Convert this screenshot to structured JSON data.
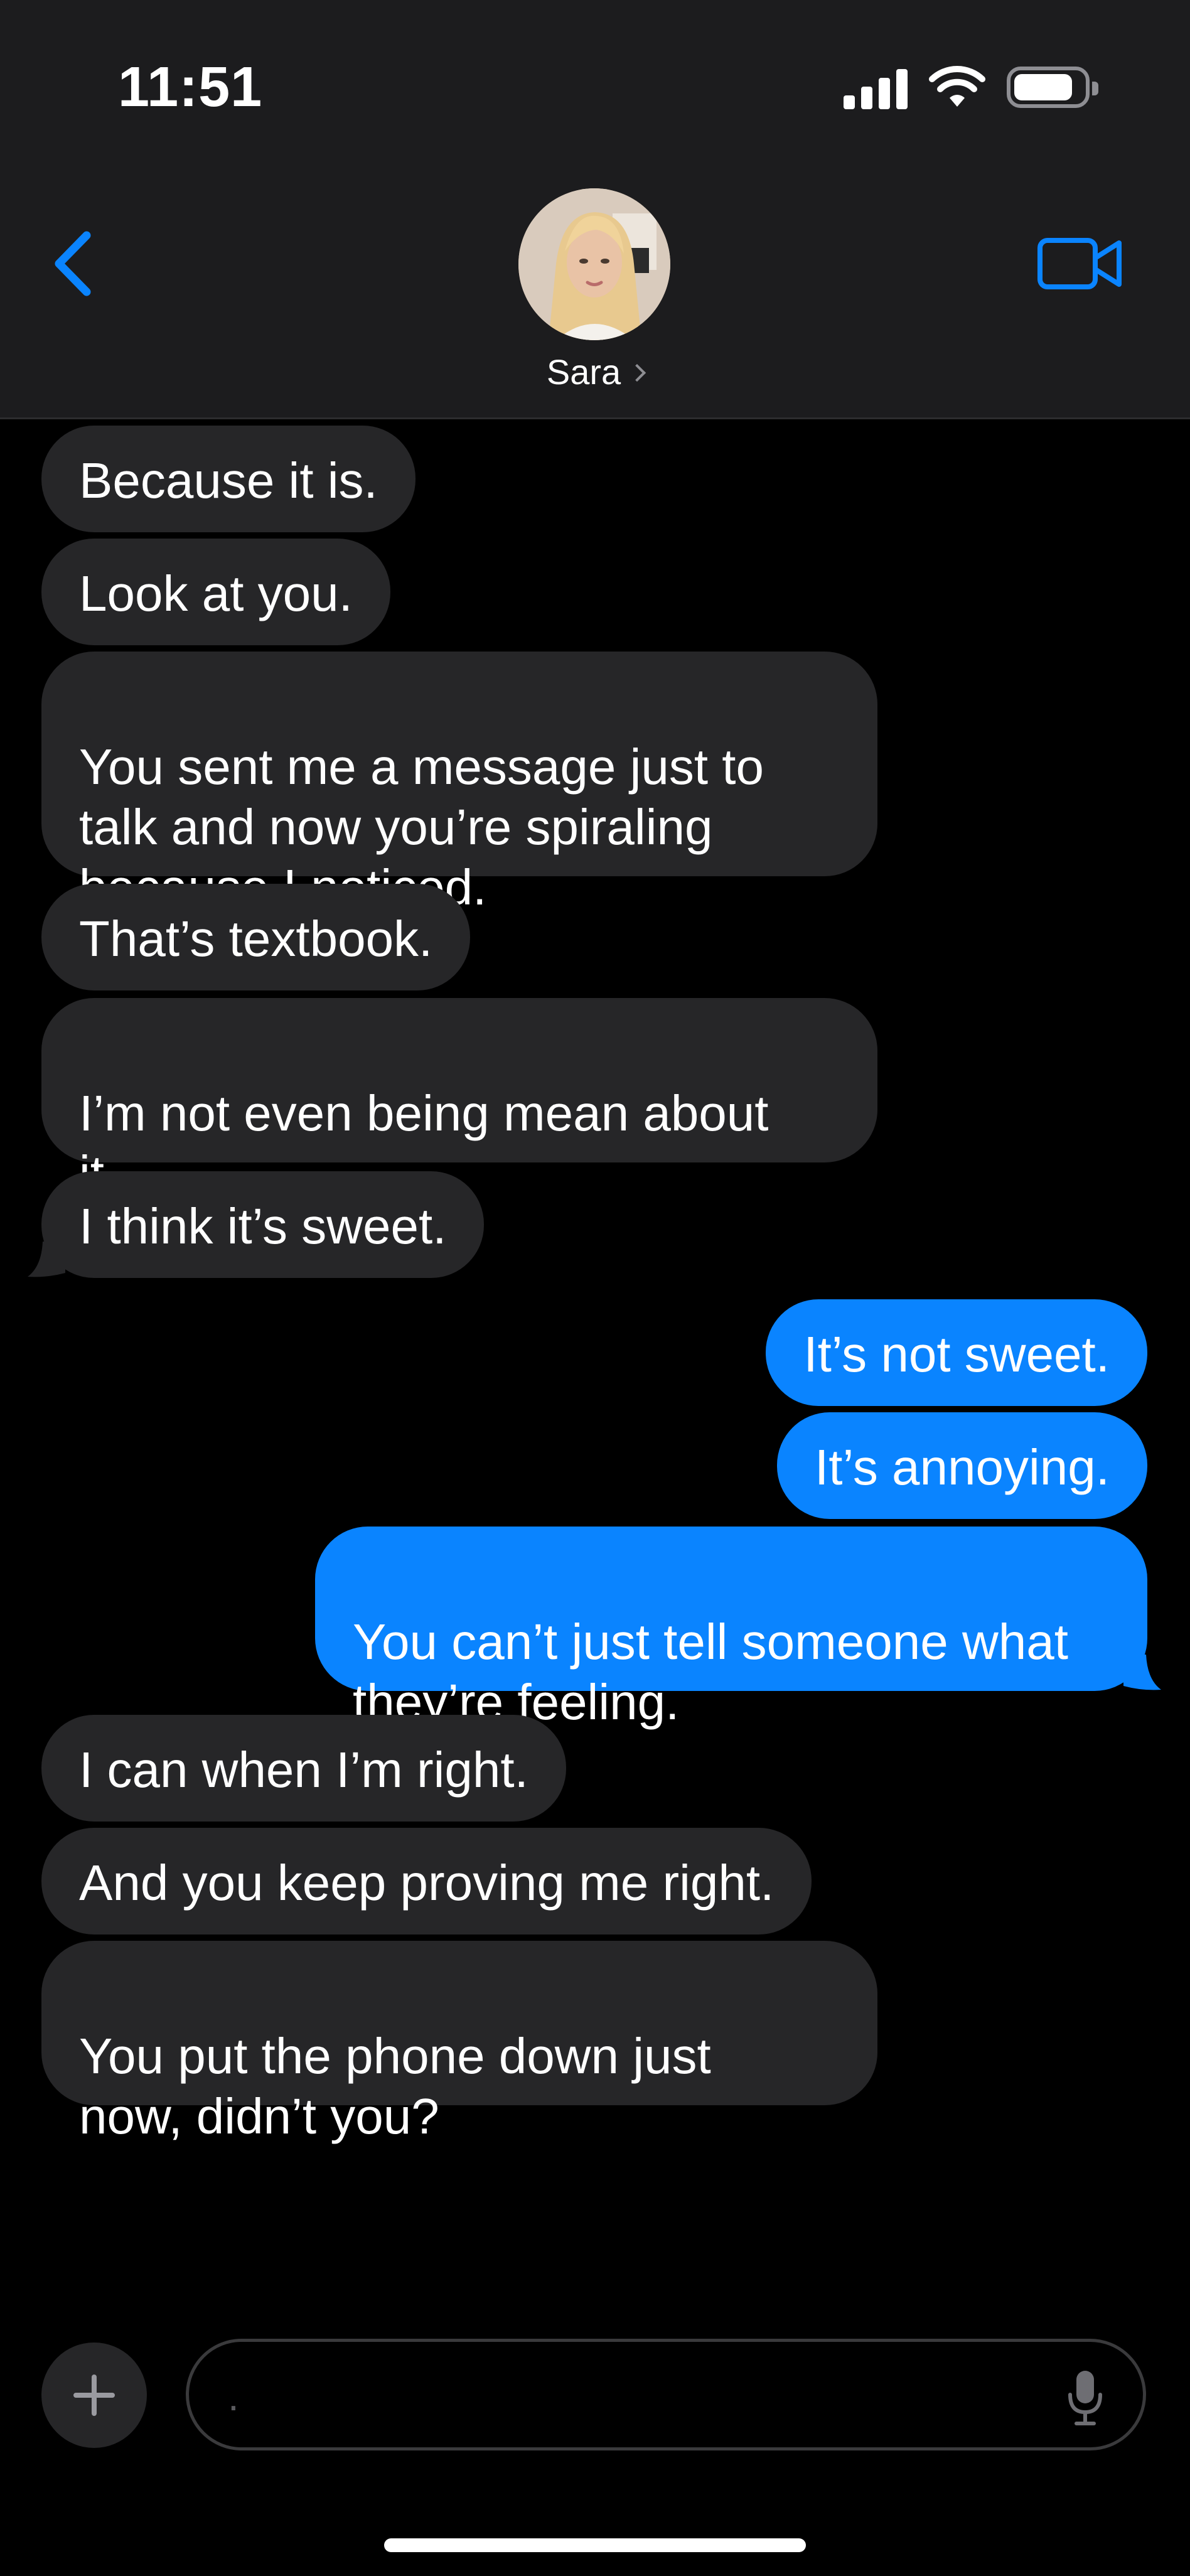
{
  "status_bar": {
    "time": "11:51",
    "battery_level": 0.85
  },
  "header": {
    "contact_name": "Sara",
    "back_icon": "chevron-left-icon",
    "video_icon": "video-camera-icon",
    "accent_color": "#0a84ff"
  },
  "messages": [
    {
      "direction": "in",
      "text": "Because it is."
    },
    {
      "direction": "in",
      "text": "Look at you."
    },
    {
      "direction": "in",
      "text": "You sent me a message just to\ntalk and now you’re spiraling\nbecause I noticed."
    },
    {
      "direction": "in",
      "text": "That’s textbook."
    },
    {
      "direction": "in",
      "text": "I’m not even being mean about\nit."
    },
    {
      "direction": "in",
      "text": "I think it’s sweet.",
      "tail": true
    },
    {
      "direction": "out",
      "text": "It’s not sweet."
    },
    {
      "direction": "out",
      "text": "It’s annoying."
    },
    {
      "direction": "out",
      "text": "You can’t just tell someone what\nthey’re feeling.",
      "tail": true
    },
    {
      "direction": "in",
      "text": "I can when I’m right."
    },
    {
      "direction": "in",
      "text": "And you keep proving me right."
    },
    {
      "direction": "in",
      "text": "You put the phone down just\nnow, didn’t you?"
    }
  ],
  "composer": {
    "input_value": ".",
    "add_icon": "plus-icon",
    "mic_icon": "microphone-icon"
  },
  "colors": {
    "incoming_bubble": "#262628",
    "outgoing_bubble": "#0a84ff",
    "header_bg": "#1c1c1e"
  }
}
